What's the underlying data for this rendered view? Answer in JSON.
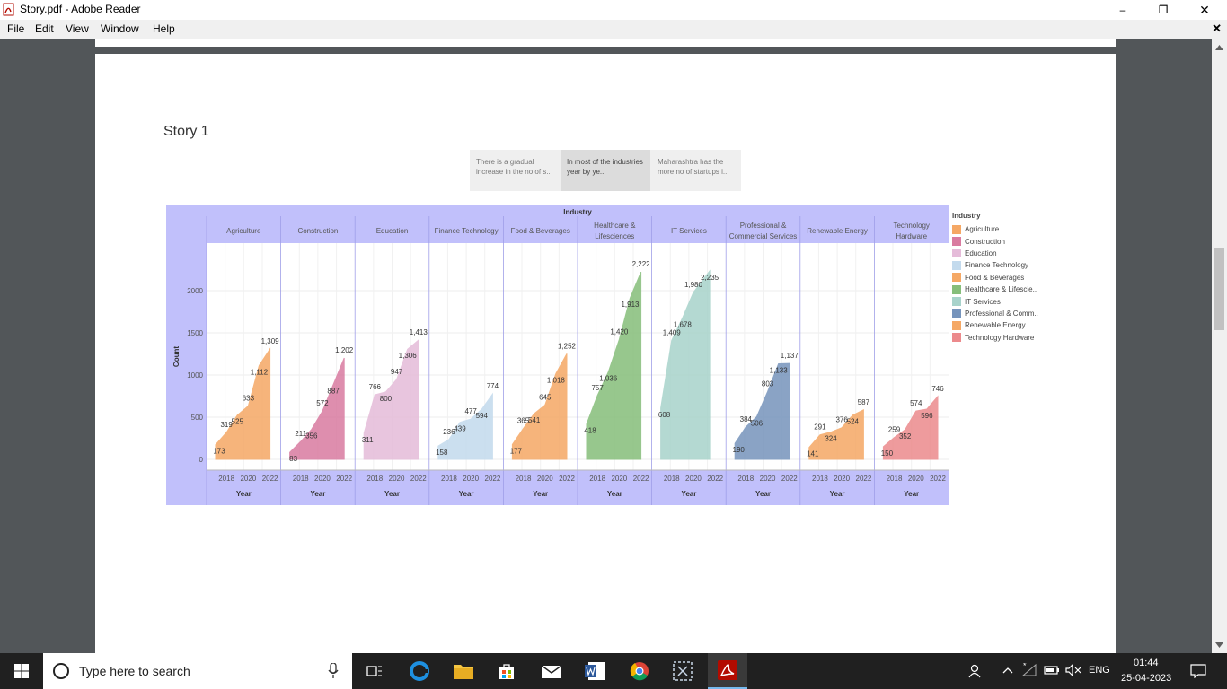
{
  "window": {
    "title": "Story.pdf - Adobe Reader",
    "minimize": "–",
    "maximize": "❐",
    "close": "✕"
  },
  "menu": {
    "items": [
      "File",
      "Edit",
      "View",
      "Window",
      "Help"
    ],
    "close_doc": "✕"
  },
  "story": {
    "title": "Story 1",
    "tabs": [
      {
        "text": "There is a gradual increase in the no of s..",
        "active": false
      },
      {
        "text": "In most of the industries year by ye..",
        "active": true
      },
      {
        "text": "Maharashtra has the more no of startups i..",
        "active": false
      }
    ]
  },
  "chart_data": {
    "type": "area",
    "title": "Industry",
    "ylabel": "Count",
    "xlabel": "Year",
    "ylim": [
      0,
      2500
    ],
    "yticks": [
      0,
      500,
      1000,
      1500,
      2000
    ],
    "x_ticks": [
      "2018",
      "2020",
      "2022"
    ],
    "x": [
      2017,
      2018,
      2019,
      2020,
      2021,
      2022
    ],
    "legend_title": "Industry",
    "legend_placement": "right",
    "series": [
      {
        "name": "Agriculture",
        "legend": "Agriculture",
        "header": [
          "Agriculture"
        ],
        "color": "#f5a865",
        "values": [
          173,
          319,
          525,
          633,
          1112,
          1309
        ],
        "labels": [
          "173",
          "319",
          "525",
          "633",
          "1,112",
          "1,309"
        ]
      },
      {
        "name": "Construction",
        "legend": "Construction",
        "header": [
          "Construction"
        ],
        "color": "#d97ba0",
        "values": [
          83,
          211,
          356,
          572,
          887,
          1202
        ],
        "labels": [
          "83",
          "211",
          "356",
          "572",
          "887",
          "1,202"
        ]
      },
      {
        "name": "Education",
        "legend": "Education",
        "header": [
          "Education"
        ],
        "color": "#e5bbd9",
        "values": [
          311,
          766,
          800,
          947,
          1306,
          1413
        ],
        "labels": [
          "311",
          "766",
          "800",
          "947",
          "1,306",
          "1,413"
        ]
      },
      {
        "name": "Finance Technology",
        "legend": "Finance Technology",
        "header": [
          "Finance Technology"
        ],
        "color": "#c3daed",
        "values": [
          158,
          236,
          439,
          477,
          594,
          774
        ],
        "labels": [
          "158",
          "236",
          "439",
          "477",
          "594",
          "774"
        ]
      },
      {
        "name": "Food & Beverages",
        "legend": "Food & Beverages",
        "header": [
          "Food & Beverages"
        ],
        "color": "#f5a865",
        "values": [
          177,
          365,
          541,
          645,
          1018,
          1252
        ],
        "labels": [
          "177",
          "365",
          "541",
          "645",
          "1,018",
          "1,252"
        ]
      },
      {
        "name": "Healthcare & Lifesciences",
        "legend": "Healthcare & Lifescie..",
        "header": [
          "Healthcare &",
          "Lifesciences"
        ],
        "color": "#86be7a",
        "values": [
          418,
          757,
          1036,
          1420,
          1913,
          2222
        ],
        "labels": [
          "418",
          "757",
          "1,036",
          "1,420",
          "1,913",
          "2,222"
        ]
      },
      {
        "name": "IT Services",
        "legend": "IT Services",
        "header": [
          "IT Services"
        ],
        "color": "#a8d3cb",
        "values": [
          608,
          1409,
          1678,
          1980,
          2235
        ],
        "labels": [
          "608",
          "1,409",
          "1,678",
          "1,980",
          "2,235"
        ],
        "x": [
          2017,
          2018,
          2019,
          2020,
          2021.5
        ]
      },
      {
        "name": "Professional & Commercial Services",
        "legend": "Professional & Comm..",
        "header": [
          "Professional &",
          "Commercial Services"
        ],
        "color": "#7694bc",
        "values": [
          190,
          384,
          506,
          803,
          1133,
          1137
        ],
        "labels": [
          "190",
          "384",
          "506",
          "803",
          "1,133",
          "1,137"
        ]
      },
      {
        "name": "Renewable Energy",
        "legend": "Renewable Energy",
        "header": [
          "Renewable Energy"
        ],
        "color": "#f5a865",
        "values": [
          141,
          291,
          324,
          376,
          524,
          587
        ],
        "labels": [
          "141",
          "291",
          "324",
          "376",
          "524",
          "587"
        ]
      },
      {
        "name": "Technology Hardware",
        "legend": "Technology Hardware",
        "header": [
          "Technology",
          "Hardware"
        ],
        "color": "#ec8a8c",
        "values": [
          150,
          259,
          352,
          574,
          596,
          746
        ],
        "labels": [
          "150",
          "259",
          "352",
          "574",
          "596",
          "746"
        ]
      }
    ]
  },
  "taskbar": {
    "search_placeholder": "Type here to search",
    "lang": "ENG",
    "time": "01:44",
    "date": "25-04-2023"
  }
}
